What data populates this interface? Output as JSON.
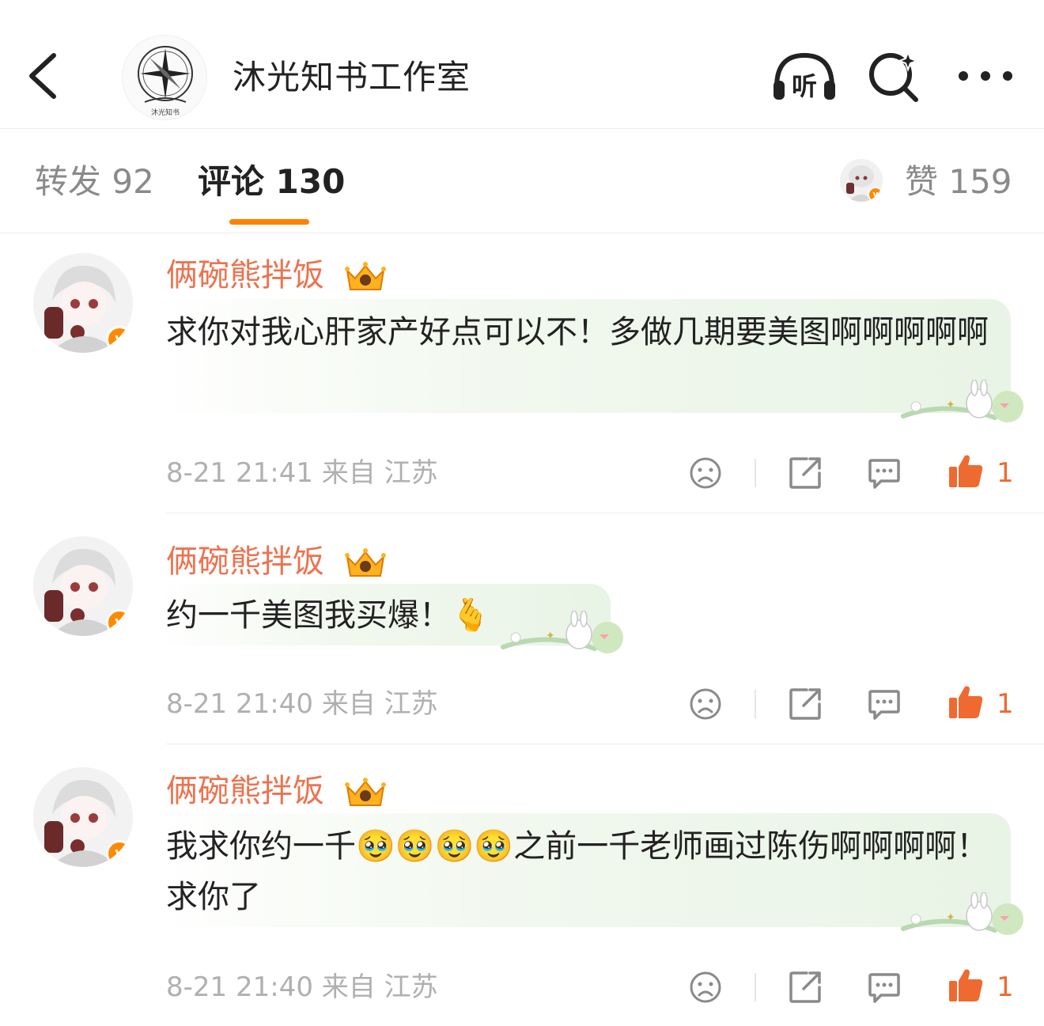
{
  "header": {
    "title": "沐光知书工作室",
    "avatar_caption": "沐光知书",
    "listen_label": "听"
  },
  "tabs": {
    "repost": "转发 92",
    "comment": "评论 130",
    "like": "赞 159"
  },
  "comments": [
    {
      "author": "俩碗熊拌饭",
      "text": "求你对我心肝家产好点可以不！多做几期要美图啊啊啊啊啊",
      "time": "8-21 21:41",
      "location": "来自 江苏",
      "likes": "1"
    },
    {
      "author": "俩碗熊拌饭",
      "text": "约一千美图我买爆！",
      "emoji": "🫰",
      "time": "8-21 21:40",
      "location": "来自 江苏",
      "likes": "1"
    },
    {
      "author": "俩碗熊拌饭",
      "text_before": "我求你约一千",
      "emojis": "🥹🥹🥹🥹",
      "text_after": "之前一千老师画过陈伤啊啊啊啊！求你了",
      "time": "8-21 21:40",
      "location": "来自 江苏",
      "likes": "1"
    }
  ],
  "icons": {
    "back": "chevron-left-icon",
    "listen": "headphones-icon",
    "search": "search-icon",
    "more": "more-dots-icon",
    "dislike": "frown-icon",
    "share": "share-icon",
    "reply": "comment-bubble-icon",
    "like": "thumbs-up-icon",
    "verified": "verified-v-badge",
    "crown": "crown-badge-icon"
  },
  "colors": {
    "accent": "#ff8200",
    "name": "#eb7350",
    "like": "#ee6a30",
    "muted": "#b0b0b0",
    "bubble": "#e8f4e6"
  }
}
